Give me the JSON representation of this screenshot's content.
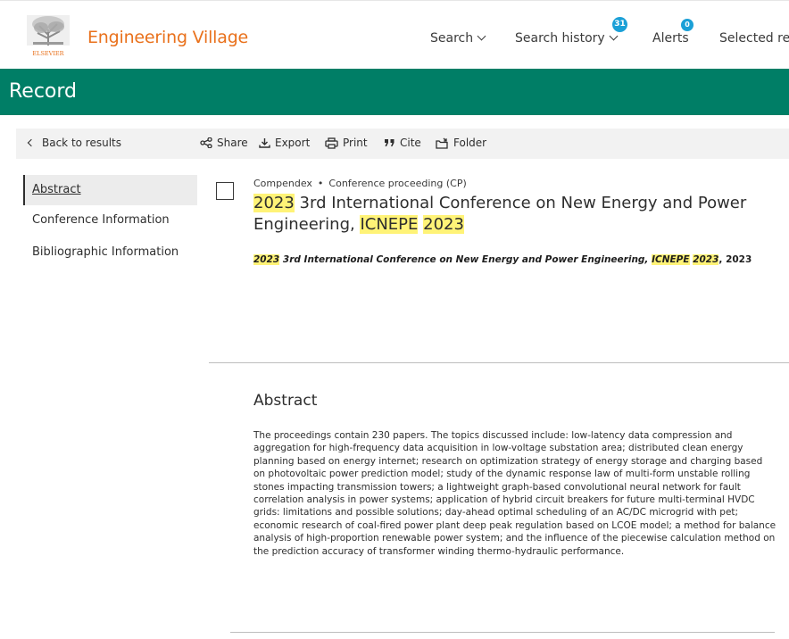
{
  "header": {
    "app_title": "Engineering Village",
    "logo_text": "ELSEVIER",
    "nav": {
      "search": "Search",
      "search_history": "Search history",
      "search_history_count": "31",
      "alerts": "Alerts",
      "alerts_count": "0",
      "selected": "Selected re"
    }
  },
  "record": {
    "title": "Record"
  },
  "toolbar": {
    "back": "Back to results",
    "share": "Share",
    "export": "Export",
    "print": "Print",
    "cite": "Cite",
    "folder": "Folder"
  },
  "sidebar": {
    "items": [
      {
        "label": "Abstract"
      },
      {
        "label": "Conference Information"
      },
      {
        "label": "Bibliographic Information"
      }
    ]
  },
  "main": {
    "database": "Compendex",
    "doc_type": "Conference proceeding (CP)",
    "title_year": "2023",
    "title_middle": " 3rd International Conference on New Energy and Power Engineering, ",
    "title_acronym": "ICNEPE",
    "title_space": " ",
    "title_year2": "2023",
    "citation_year": "2023",
    "citation_middle": " 3rd International Conference on New Energy and Power Engineering, ",
    "citation_acronym": "ICNEPE",
    "citation_space": " ",
    "citation_year2": "2023",
    "citation_tail": ", 2023",
    "abstract_heading": "Abstract",
    "abstract_text": "The proceedings contain 230 papers. The topics discussed include: low-latency data compression and aggregation for high-frequency data acquisition in low-voltage substation area; distributed clean energy planning based on energy internet; research on optimization strategy of energy storage and charging based on photovoltaic power prediction model; study of the dynamic response law of multi-form unstable rolling stones impacting transmission towers; a lightweight graph-based convolutional neural network for fault correlation analysis in power systems; application of hybrid circuit breakers for future multi-terminal HVDC grids: limitations and possible solutions; day-ahead optimal scheduling of an AC/DC microgrid with pet; economic research of coal-fired power plant deep peak regulation based on LCOE model; a method for balance analysis of high-proportion renewable power system; and the influence of the piecewise calculation method on the prediction accuracy of transformer winding thermo-hydraulic performance."
  },
  "colors": {
    "brand_orange": "#e9711c",
    "record_green": "#007e66",
    "badge_blue": "#1ba0d7",
    "highlight": "#fff377"
  }
}
